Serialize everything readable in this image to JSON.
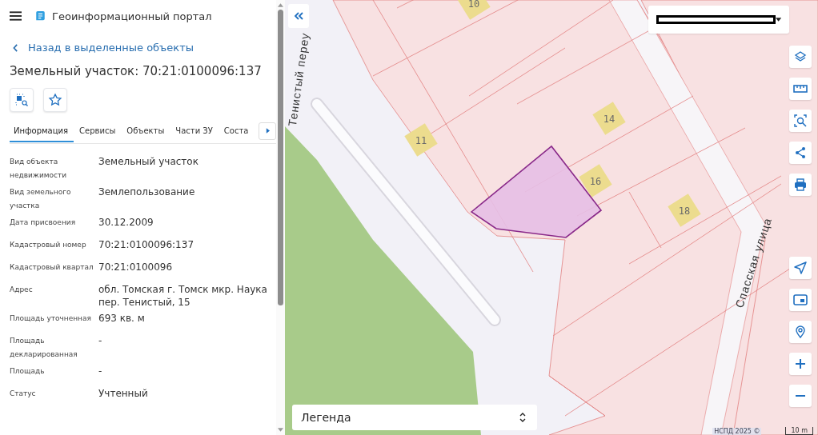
{
  "header": {
    "title": "Геоинформационный портал"
  },
  "back_link": "Назад в выделенные объекты",
  "object_title": "Земельный участок: 70:21:0100096:137",
  "tabs": [
    {
      "label": "Информация",
      "selected": true
    },
    {
      "label": "Сервисы",
      "selected": false
    },
    {
      "label": "Объекты",
      "selected": false
    },
    {
      "label": "Части ЗУ",
      "selected": false
    },
    {
      "label": "Соста",
      "selected": false
    }
  ],
  "properties": [
    {
      "label": "Вид объекта недвижимости",
      "value": "Земельный участок"
    },
    {
      "label": "Вид земельного участка",
      "value": "Землепользование"
    },
    {
      "label": "Дата присвоения",
      "value": "30.12.2009"
    },
    {
      "label": "Кадастровый номер",
      "value": "70:21:0100096:137"
    },
    {
      "label": "Кадастровый квартал",
      "value": "70:21:0100096"
    },
    {
      "label": "Адрес",
      "value": "обл. Томская г. Томск мкр. Наука пер. Тенистый, 15"
    },
    {
      "label": "Площадь уточненная",
      "value": "693 кв. м"
    },
    {
      "label": "Площадь декларированная",
      "value": "-"
    },
    {
      "label": "Площадь",
      "value": "-"
    },
    {
      "label": "Статус",
      "value": "Учтенный"
    }
  ],
  "map": {
    "streets": [
      "Тенистый переу",
      "Спасская улица"
    ],
    "plots": [
      "10",
      "11",
      "14",
      "16",
      "18"
    ],
    "legend": "Легенда",
    "attribution": "НСПД 2025 ©",
    "scale": "10 m"
  }
}
